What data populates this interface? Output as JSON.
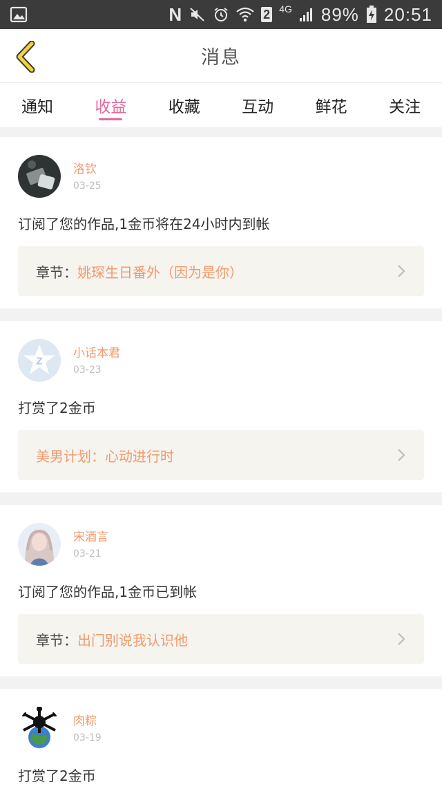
{
  "status_bar": {
    "sim_badge": "2",
    "network": "4G",
    "battery": "89%",
    "time": "20:51",
    "n_icon": "N"
  },
  "header": {
    "title": "消息"
  },
  "tabs": [
    {
      "label": "通知",
      "active": false
    },
    {
      "label": "收益",
      "active": true
    },
    {
      "label": "收藏",
      "active": false
    },
    {
      "label": "互动",
      "active": false
    },
    {
      "label": "鲜花",
      "active": false
    },
    {
      "label": "关注",
      "active": false
    }
  ],
  "items": [
    {
      "username": "洛钦",
      "date": "03-25",
      "message": "订阅了您的作品,1金币将在24小时内到帐",
      "link_label": "章节：",
      "link_text": "姚琛生日番外（因为是你）"
    },
    {
      "username": "小话本君",
      "date": "03-23",
      "message": "打赏了2金币",
      "link_label": "",
      "link_text": "美男计划：心动进行时"
    },
    {
      "username": "宋酒言",
      "date": "03-21",
      "message": "订阅了您的作品,1金币已到帐",
      "link_label": "章节：",
      "link_text": "出门别说我认识他"
    },
    {
      "username": "肉粽",
      "date": "03-19",
      "message": "打赏了2金币"
    }
  ],
  "colors": {
    "accent_pink": "#e8679e",
    "username_orange": "#f39a6c",
    "back_yellow": "#f4d23c"
  }
}
